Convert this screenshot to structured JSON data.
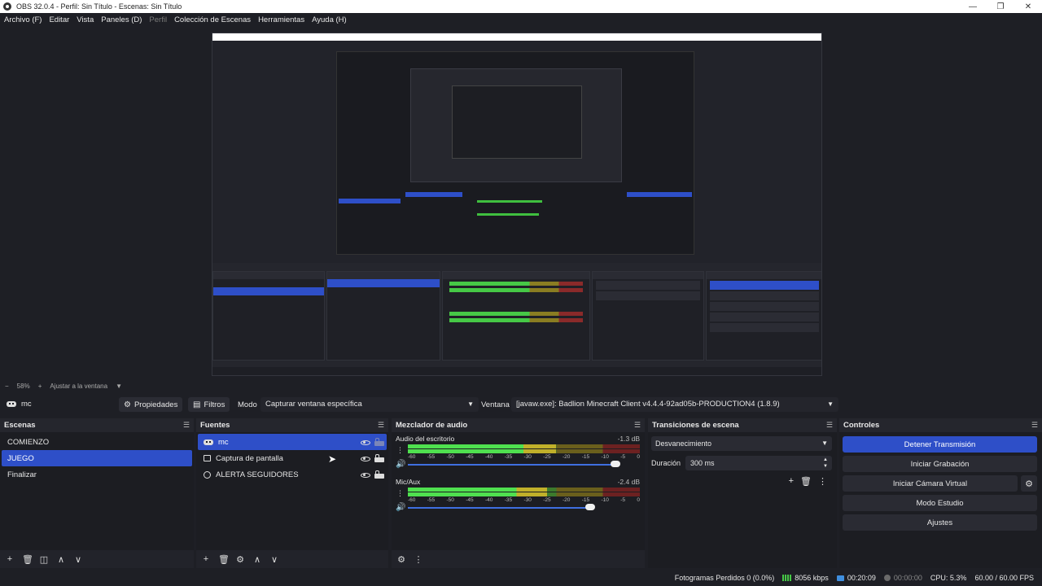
{
  "window": {
    "title": "OBS 32.0.4 - Perfil: Sin Título - Escenas: Sin Título",
    "controls": [
      "—",
      "❐",
      "✕"
    ]
  },
  "menu": [
    {
      "label": "Archivo (F)",
      "enabled": true
    },
    {
      "label": "Editar",
      "enabled": true
    },
    {
      "label": "Vista",
      "enabled": true
    },
    {
      "label": "Paneles (D)",
      "enabled": true
    },
    {
      "label": "Perfil",
      "enabled": false
    },
    {
      "label": "Colección de Escenas",
      "enabled": true
    },
    {
      "label": "Herramientas",
      "enabled": true
    },
    {
      "label": "Ayuda (H)",
      "enabled": true
    }
  ],
  "zoom": {
    "minus": "−",
    "value": "58%",
    "plus": "+",
    "fit": "Ajustar a la ventana",
    "caret": "▼"
  },
  "source_bar": {
    "source_name": "mc",
    "properties_label": "Propiedades",
    "filters_label": "Filtros",
    "mode_label": "Modo",
    "mode_value": "Capturar ventana específica",
    "window_label": "Ventana",
    "window_value": "[javaw.exe]: Badlion Minecraft Client v4.4.4-92ad05b-PRODUCTION4 (1.8.9)"
  },
  "scenes": {
    "title": "Escenas",
    "items": [
      {
        "label": "COMIENZO",
        "selected": false
      },
      {
        "label": "JUEGO",
        "selected": true
      },
      {
        "label": "Finalizar",
        "selected": false
      }
    ],
    "footer": [
      "+",
      "🗑",
      "◫",
      "∧",
      "∨"
    ]
  },
  "sources": {
    "title": "Fuentes",
    "items": [
      {
        "label": "mc",
        "icon": "gamepad-icon",
        "selected": true,
        "locked": false
      },
      {
        "label": "Captura de pantalla",
        "icon": "monitor-icon",
        "selected": false,
        "locked": true
      },
      {
        "label": "ALERTA SEGUIDORES",
        "icon": "globe-icon",
        "selected": false,
        "locked": true
      }
    ],
    "footer": [
      "+",
      "🗑",
      "⚙",
      "∧",
      "∨"
    ]
  },
  "mixer": {
    "title": "Mezclador de audio",
    "tracks": [
      {
        "name": "Audio del escritorio",
        "db": "-1.3 dB",
        "level": 0.64,
        "volume": 0.91
      },
      {
        "name": "Mic/Aux",
        "db": "-2.4 dB",
        "level": 0.6,
        "volume": 0.8
      }
    ],
    "ticks": [
      "-60",
      "-55",
      "-50",
      "-45",
      "-40",
      "-35",
      "-30",
      "-25",
      "-20",
      "-15",
      "-10",
      "-5",
      "0"
    ],
    "footer": [
      "⚙",
      "⋮"
    ]
  },
  "transitions": {
    "title": "Transiciones de escena",
    "selected": "Desvanecimiento",
    "duration_label": "Duración",
    "duration_value": "300 ms",
    "tools": [
      "+",
      "🗑",
      "⋮"
    ]
  },
  "controls": {
    "title": "Controles",
    "buttons": [
      {
        "label": "Detener Transmisión",
        "active": true
      },
      {
        "label": "Iniciar Grabación",
        "active": false
      },
      {
        "label": "Iniciar Cámara Virtual",
        "active": false
      },
      {
        "label": "Modo Estudio",
        "active": false
      },
      {
        "label": "Ajustes",
        "active": false
      }
    ]
  },
  "status": {
    "dropped_frames": "Fotogramas Perdidos 0 (0.0%)",
    "bitrate": "8056 kbps",
    "stream_time": "00:20:09",
    "rec_time": "00:00:00",
    "cpu": "CPU: 5.3%",
    "fps": "60.00 / 60.00 FPS"
  },
  "colors": {
    "accent": "#2e4fc8",
    "bg": "#1e1f25",
    "meter_green": "#4fe04f"
  }
}
